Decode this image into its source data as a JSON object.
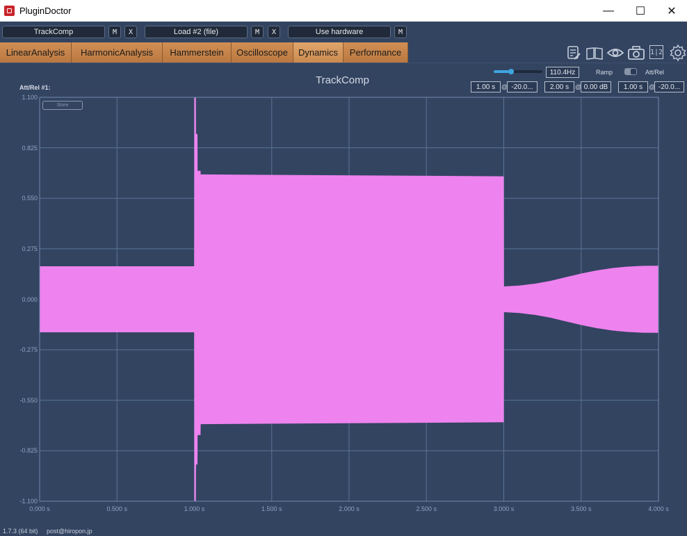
{
  "window": {
    "title": "PluginDoctor",
    "minimize": "—",
    "maximize": "☐",
    "close": "✕"
  },
  "toolbar": {
    "plugin1": "TrackComp",
    "plugin1_m": "M",
    "plugin1_x": "X",
    "plugin2": "Load #2 (file)",
    "plugin2_m": "M",
    "plugin2_x": "X",
    "hardware": "Use hardware",
    "hardware_m": "M"
  },
  "tabs": [
    "LinearAnalysis",
    "HarmonicAnalysis",
    "Hammerstein",
    "Oscilloscope",
    "Dynamics",
    "Performance"
  ],
  "active_tab": "Dynamics",
  "icons": [
    "notes-icon",
    "book-icon",
    "eye-icon",
    "camera-icon",
    "split-view-icon",
    "gear-icon"
  ],
  "split_label": "1|2",
  "plot": {
    "title": "TrackComp",
    "att_rel_label": "Att/Rel #1:",
    "store_label": "Store",
    "frequency": "110.4Hz",
    "frequency_slider_fraction": 0.35,
    "ramp_label": "Ramp",
    "att_rel_toggle_label": "Att/Rel",
    "seg1_time": "1.00 s",
    "seg1_level": "-20.0...",
    "seg2_time": "2.00 s",
    "seg2_level": "0.00 dB",
    "seg3_time": "1.00 s",
    "seg3_level": "-20.0...",
    "at_symbol": "@"
  },
  "chart_data": {
    "type": "area",
    "xlim": [
      0,
      4
    ],
    "ylim": [
      -1.1,
      1.1
    ],
    "x_ticks": [
      "0.000 s",
      "0.500 s",
      "1.000 s",
      "1.500 s",
      "2.000 s",
      "2.500 s",
      "3.000 s",
      "3.500 s",
      "4.000 s"
    ],
    "y_ticks": [
      "1.100",
      "0.825",
      "0.550",
      "0.275",
      "0.000",
      "-0.275",
      "-0.550",
      "-0.825",
      "-1.100"
    ],
    "grid": true,
    "series_color": "#ee82ee",
    "envelope": {
      "x": [
        0.0,
        0.999,
        1.0,
        1.01,
        1.011,
        1.02,
        1.021,
        1.04,
        1.041,
        3.0,
        3.001,
        3.1,
        3.2,
        3.3,
        3.4,
        3.5,
        3.6,
        3.7,
        3.8,
        3.9,
        4.0
      ],
      "upper": [
        0.18,
        0.18,
        1.1,
        1.1,
        0.9,
        0.9,
        0.7,
        0.7,
        0.68,
        0.67,
        0.07,
        0.075,
        0.085,
        0.1,
        0.12,
        0.14,
        0.157,
        0.17,
        0.178,
        0.182,
        0.183
      ],
      "lower": [
        -0.18,
        -0.18,
        -1.1,
        -1.1,
        -0.9,
        -0.9,
        -0.74,
        -0.74,
        -0.68,
        -0.67,
        -0.07,
        -0.075,
        -0.085,
        -0.1,
        -0.12,
        -0.14,
        -0.157,
        -0.17,
        -0.178,
        -0.182,
        -0.183
      ]
    }
  },
  "status": {
    "version": "1.7.3 (64 bit)",
    "email": "post@hiropon.jp"
  }
}
